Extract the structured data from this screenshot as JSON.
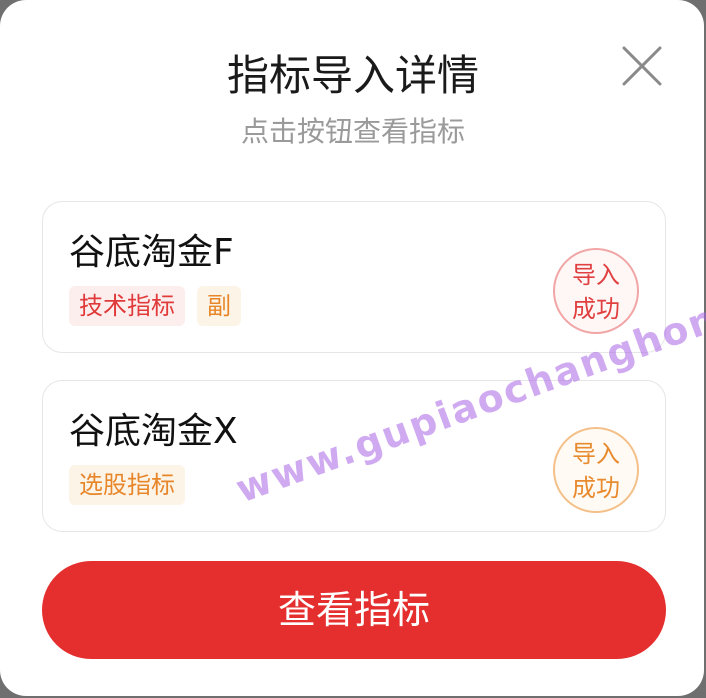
{
  "dialog": {
    "title": "指标导入详情",
    "subtitle": "点击按钮查看指标",
    "close_icon": "close-icon"
  },
  "indicators": [
    {
      "name": "谷底淘金F",
      "tags": [
        "技术指标",
        "副"
      ],
      "status_line1": "导入",
      "status_line2": "成功",
      "status_color": "#e04040"
    },
    {
      "name": "谷底淘金X",
      "tags": [
        "选股指标"
      ],
      "status_line1": "导入",
      "status_line2": "成功",
      "status_color": "#e88a2e"
    }
  ],
  "actions": {
    "view_button_label": "查看指标"
  },
  "watermark": {
    "text": "www.gupiaochanghong.com"
  },
  "colors": {
    "primary_red": "#e52e2e",
    "tag_red_text": "#e03a3a",
    "tag_orange_text": "#e8862a"
  }
}
